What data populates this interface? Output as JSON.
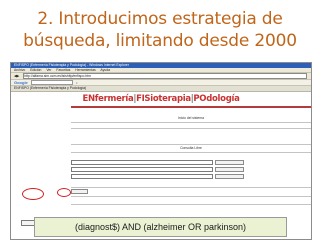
{
  "slide": {
    "title_line1": "2. Introducimos estrategia de",
    "title_line2": "búsqueda, limitando desde 2000",
    "caption": "(diagnost$) AND (alzheimer OR parkinson)"
  },
  "browser": {
    "window_title": "ENFISPO (Enfermería Fisioterapia y Podología) - Windows Internet Explorer",
    "menu": [
      "Archivo",
      "Edición",
      "Ver",
      "Favoritos",
      "Herramientas",
      "Ayuda"
    ],
    "address": "http://alfama.sim.ucm.es/isishttp/enfispo.htm",
    "search_engine": "Google",
    "tab_label": "ENFISPO (Enfermería Fisioterapia y Podología)"
  },
  "site": {
    "brand_1": "ENfermería",
    "brand_sep1": "|",
    "brand_2": "FISioterapia",
    "brand_sep2": "|",
    "brand_3": "POdología",
    "section_search": "Inicio del sistema",
    "section_query": "Consulta Libre"
  },
  "colors": {
    "title": "#c0651a",
    "brand": "#c83232",
    "caption_bg": "#eaf2d3"
  }
}
